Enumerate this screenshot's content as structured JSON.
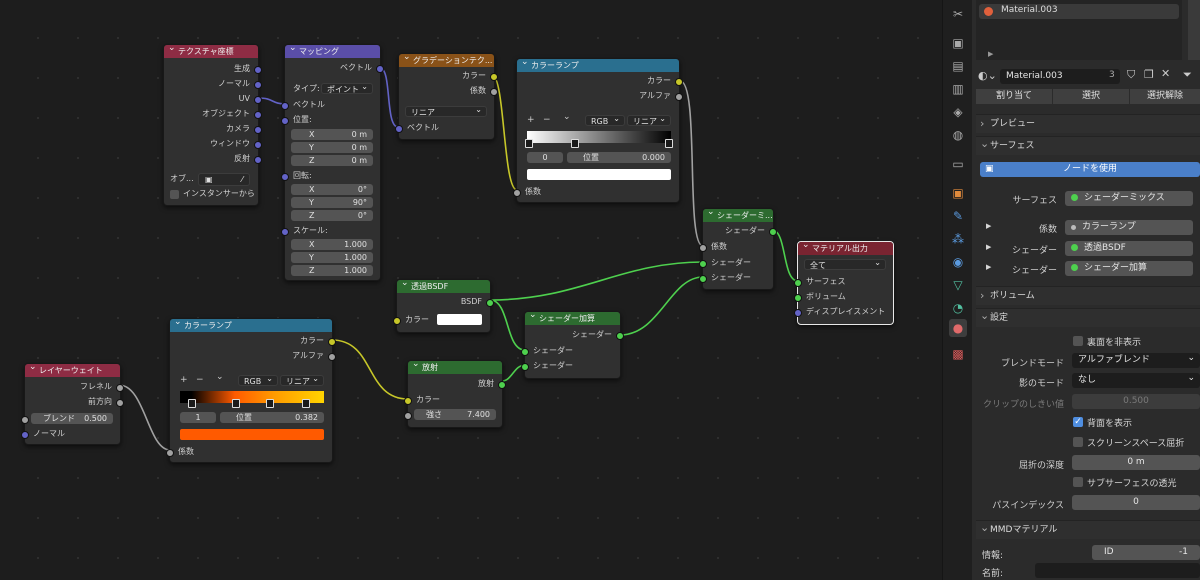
{
  "nodes": {
    "texcoord": {
      "title": "テクスチャ座標",
      "outputs": [
        "生成",
        "ノーマル",
        "UV",
        "オブジェクト",
        "カメラ",
        "ウィンドウ",
        "反射"
      ],
      "obj_label": "オブ...",
      "instancer": "インスタンサーから"
    },
    "mapping": {
      "title": "マッピング",
      "out": "ベクトル",
      "type_label": "タイプ:",
      "type_value": "ポイント",
      "in_vector": "ベクトル",
      "loc_label": "位置:",
      "loc": [
        [
          "X",
          "0 m"
        ],
        [
          "Y",
          "0 m"
        ],
        [
          "Z",
          "0 m"
        ]
      ],
      "rot_label": "回転:",
      "rot": [
        [
          "X",
          "0°"
        ],
        [
          "Y",
          "90°"
        ],
        [
          "Z",
          "0°"
        ]
      ],
      "scale_label": "スケール:",
      "scale": [
        [
          "X",
          "1.000"
        ],
        [
          "Y",
          "1.000"
        ],
        [
          "Z",
          "1.000"
        ]
      ]
    },
    "gradient": {
      "title": "グラデーションテク...",
      "out_color": "カラー",
      "out_fac": "係数",
      "mode": "リニア",
      "in_vector": "ベクトル"
    },
    "ramp1": {
      "title": "カラーランプ",
      "out_color": "カラー",
      "out_alpha": "アルファ",
      "plus": "+",
      "minus": "−",
      "chev": "⌄",
      "color_mode": "RGB",
      "interp": "リニア",
      "index": "0",
      "pos_label": "位置",
      "pos": "0.000",
      "in_fac": "係数"
    },
    "mixshader": {
      "title": "シェーダーミ...",
      "out": "シェーダー",
      "in_fac": "係数",
      "in_s1": "シェーダー",
      "in_s2": "シェーダー"
    },
    "output": {
      "title": "マテリアル出力",
      "target": "全て",
      "in_surface": "サーフェス",
      "in_volume": "ボリューム",
      "in_disp": "ディスプレイスメント"
    },
    "transp": {
      "title": "透過BSDF",
      "out": "BSDF",
      "in_color": "カラー"
    },
    "addshader": {
      "title": "シェーダー加算",
      "out": "シェーダー",
      "in_s1": "シェーダー",
      "in_s2": "シェーダー"
    },
    "ramp2": {
      "title": "カラーランプ",
      "out_color": "カラー",
      "out_alpha": "アルファ",
      "plus": "+",
      "minus": "−",
      "chev": "⌄",
      "color_mode": "RGB",
      "interp": "リニア",
      "index": "1",
      "pos_label": "位置",
      "pos": "0.382",
      "in_fac": "係数"
    },
    "emission": {
      "title": "放射",
      "out": "放射",
      "in_color": "カラー",
      "strength_label": "強さ",
      "strength": "7.400"
    },
    "layerweight": {
      "title": "レイヤーウェイト",
      "out_fresnel": "フレネル",
      "out_facing": "前方向",
      "blend_label": "ブレンド",
      "blend": "0.500",
      "in_normal": "ノーマル"
    }
  },
  "panel": {
    "slot_name": "Material.003",
    "mat_name": "Material.003",
    "users": "3",
    "assign": "割り当て",
    "select": "選択",
    "deselect": "選択解除",
    "sec_preview": "プレビュー",
    "sec_surface": "サーフェス",
    "use_nodes": "ノードを使用",
    "surface_label": "サーフェス",
    "surface_value": "シェーダーミックス",
    "fac_label": "係数",
    "fac_value": "カラーランプ",
    "sh1_label": "シェーダー",
    "sh1_value": "透過BSDF",
    "sh2_label": "シェーダー",
    "sh2_value": "シェーダー加算",
    "sec_volume": "ボリューム",
    "sec_settings": "設定",
    "backface_cull": "裏面を非表示",
    "blend_label": "ブレンドモード",
    "blend_value": "アルファブレンド",
    "shadow_label": "影のモード",
    "shadow_value": "なし",
    "clip_label": "クリップのしきい値",
    "clip_value": "0.500",
    "show_backface": "背面を表示",
    "ss_refraction": "スクリーンスペース屈折",
    "refr_label": "屈折の深度",
    "refr_value": "0 m",
    "sss_transl": "サブサーフェスの透光",
    "pass_label": "パスインデックス",
    "pass_value": "0",
    "sec_mmd": "MMDマテリアル",
    "info_label": "情報:",
    "id_label": "ID",
    "id_value": "-1",
    "name_label": "名前:"
  },
  "colors": {
    "ramp2_swatch": "#ff5a00",
    "ramp1_swatch": "#ffffff",
    "transp_swatch": "#ffffff",
    "use_nodes": "#4a7fc9"
  }
}
